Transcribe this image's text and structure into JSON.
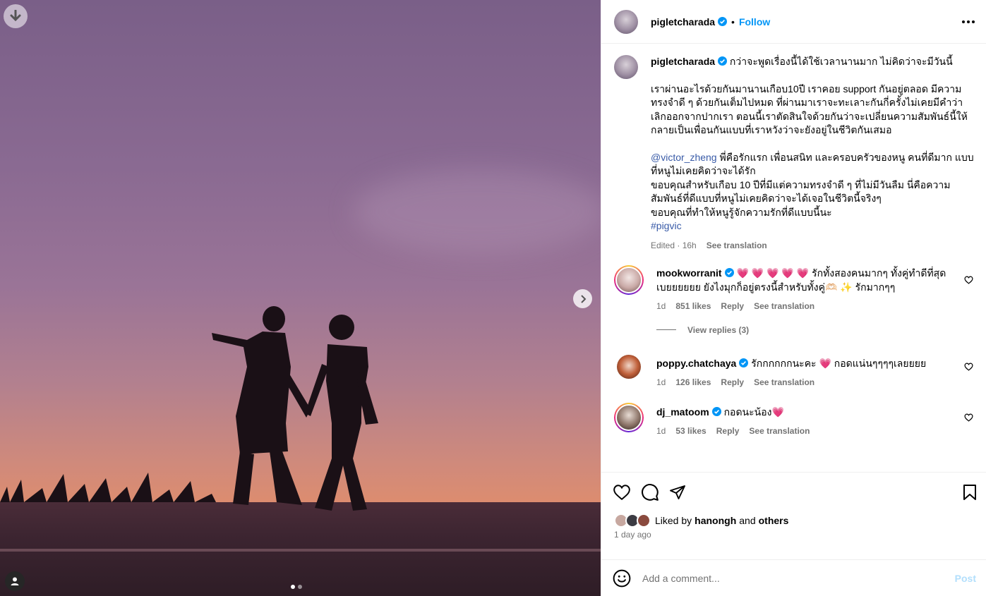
{
  "post": {
    "username": "pigletcharada",
    "follow_label": "Follow",
    "separator": "•",
    "caption_first_line": "กว่าจะพูดเรื่องนี้ได้ใช้เวลานานมาก ไม่คิดว่าจะมีวันนี้",
    "caption_para1": "เราผ่านอะไรด้วยกันมานานเกือบ10ปี เราคอย support กันอยู่ตลอด มีความทรงจำดี ๆ ด้วยกันเต็มไปหมด ที่ผ่านมาเราจะทะเลาะกันกี่ครั้งไม่เคยมีคำว่าเลิกออกจากปากเรา ตอนนี้เราตัดสินใจด้วยกันว่าจะเปลี่ยนความสัมพันธ์นี้ให้กลายเป็นเพื่อนกันแบบที่เราหวังว่าจะยังอยู่ในชีวิตกันเสมอ",
    "mention": "@victor_zheng",
    "caption_para2_rest": " พี่คือรักแรก เพื่อนสนิท และครอบครัวของหนู คนที่ดีมาก แบบที่หนูไม่เคยคิดว่าจะได้รัก\nขอบคุณสำหรับเกือบ 10 ปีที่มีแต่ความทรงจำดี ๆ ที่ไม่มีวันลืม นี่คือความสัมพันธ์ที่ดีแบบที่หนูไม่เคยคิดว่าจะได้เจอในชีวิตนี้จริงๆ\nขอบคุณที่ทำให้หนูรู้จักความรักที่ดีแบบนี้นะ",
    "hashtag": "#pigvic",
    "edited": "Edited · 16h",
    "see_translation": "See translation"
  },
  "comments": [
    {
      "username": "mookworranit",
      "text": "💗 💗 💗 💗 💗  รักทั้งสองคนมากๆ ทั้งคู่ทำดีที่สุดเบยยยยยย ยังไงมุกก็อยู่ตรงนี้สำหรับทั้งคู่🫶🏻 ✨ รักมากๆๆ",
      "time": "1d",
      "likes": "851 likes",
      "reply": "Reply",
      "see_translation": "See translation",
      "view_replies": "View replies (3)"
    },
    {
      "username": "poppy.chatchaya",
      "text": "รักกกกกกนะคะ 💗 กอดแน่นๆๆๆๆเลยยยย",
      "time": "1d",
      "likes": "126 likes",
      "reply": "Reply",
      "see_translation": "See translation"
    },
    {
      "username": "dj_matoom",
      "text": "กอดนะน้อง💗",
      "time": "1d",
      "likes": "53 likes",
      "reply": "Reply",
      "see_translation": "See translation"
    }
  ],
  "likes_bar": {
    "liked_by": "Liked by",
    "liker": "hanongh",
    "and": "and",
    "others": "others",
    "date": "1 day ago"
  },
  "add_comment": {
    "placeholder": "Add a comment...",
    "post_label": "Post"
  },
  "carousel": {
    "current": 1,
    "total": 2
  },
  "colors": {
    "accent": "#0095f6",
    "link": "#385aa7",
    "verified": "#0095f6",
    "muted": "#737373"
  },
  "icons": [
    "download-icon",
    "chevron-right-icon",
    "user-tag-icon",
    "verified-icon",
    "more-icon",
    "heart-icon",
    "comment-icon",
    "share-icon",
    "bookmark-icon",
    "emoji-icon"
  ]
}
